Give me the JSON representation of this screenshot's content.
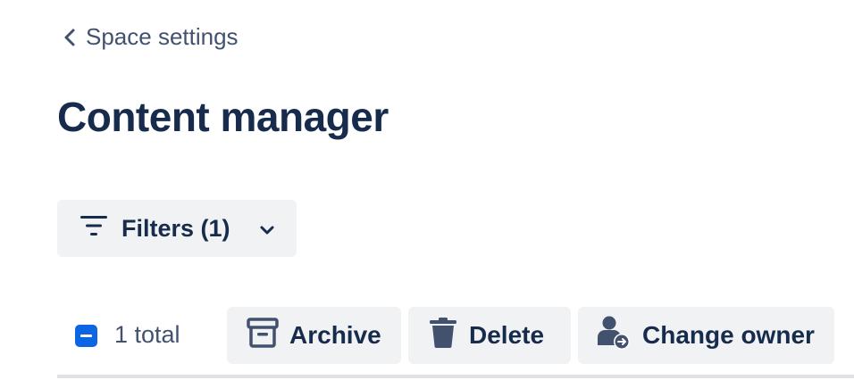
{
  "breadcrumb": {
    "label": "Space settings",
    "icon": "chevron-left-icon"
  },
  "page": {
    "title": "Content manager"
  },
  "filters": {
    "label": "Filters (1)",
    "icon": "filter-icon",
    "dropdown_icon": "chevron-down-icon"
  },
  "selection": {
    "state": "indeterminate",
    "total_label": "1 total"
  },
  "actions": {
    "archive_label": "Archive",
    "delete_label": "Delete",
    "change_owner_label": "Change owner"
  },
  "colors": {
    "text_primary": "#172B4D",
    "text_subtle": "#42526E",
    "button_bg": "#F1F2F4",
    "checkbox_accent": "#0C66E4",
    "divider": "#DFE1E6"
  }
}
